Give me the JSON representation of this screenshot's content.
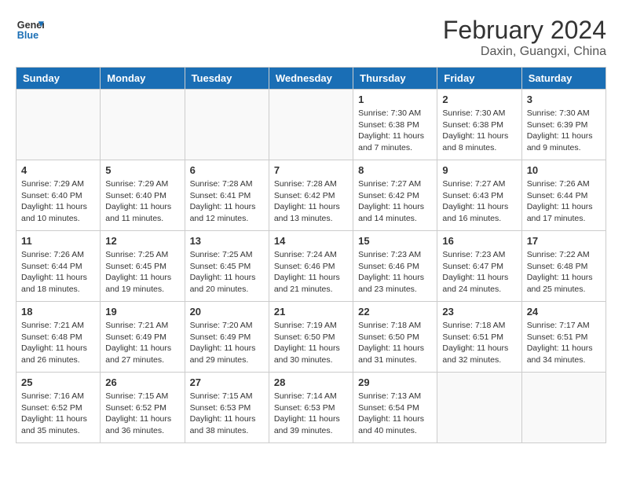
{
  "header": {
    "logo_line1": "General",
    "logo_line2": "Blue",
    "title": "February 2024",
    "subtitle": "Daxin, Guangxi, China"
  },
  "weekdays": [
    "Sunday",
    "Monday",
    "Tuesday",
    "Wednesday",
    "Thursday",
    "Friday",
    "Saturday"
  ],
  "weeks": [
    [
      {
        "day": "",
        "info": ""
      },
      {
        "day": "",
        "info": ""
      },
      {
        "day": "",
        "info": ""
      },
      {
        "day": "",
        "info": ""
      },
      {
        "day": "1",
        "info": "Sunrise: 7:30 AM\nSunset: 6:38 PM\nDaylight: 11 hours and 7 minutes."
      },
      {
        "day": "2",
        "info": "Sunrise: 7:30 AM\nSunset: 6:38 PM\nDaylight: 11 hours and 8 minutes."
      },
      {
        "day": "3",
        "info": "Sunrise: 7:30 AM\nSunset: 6:39 PM\nDaylight: 11 hours and 9 minutes."
      }
    ],
    [
      {
        "day": "4",
        "info": "Sunrise: 7:29 AM\nSunset: 6:40 PM\nDaylight: 11 hours and 10 minutes."
      },
      {
        "day": "5",
        "info": "Sunrise: 7:29 AM\nSunset: 6:40 PM\nDaylight: 11 hours and 11 minutes."
      },
      {
        "day": "6",
        "info": "Sunrise: 7:28 AM\nSunset: 6:41 PM\nDaylight: 11 hours and 12 minutes."
      },
      {
        "day": "7",
        "info": "Sunrise: 7:28 AM\nSunset: 6:42 PM\nDaylight: 11 hours and 13 minutes."
      },
      {
        "day": "8",
        "info": "Sunrise: 7:27 AM\nSunset: 6:42 PM\nDaylight: 11 hours and 14 minutes."
      },
      {
        "day": "9",
        "info": "Sunrise: 7:27 AM\nSunset: 6:43 PM\nDaylight: 11 hours and 16 minutes."
      },
      {
        "day": "10",
        "info": "Sunrise: 7:26 AM\nSunset: 6:44 PM\nDaylight: 11 hours and 17 minutes."
      }
    ],
    [
      {
        "day": "11",
        "info": "Sunrise: 7:26 AM\nSunset: 6:44 PM\nDaylight: 11 hours and 18 minutes."
      },
      {
        "day": "12",
        "info": "Sunrise: 7:25 AM\nSunset: 6:45 PM\nDaylight: 11 hours and 19 minutes."
      },
      {
        "day": "13",
        "info": "Sunrise: 7:25 AM\nSunset: 6:45 PM\nDaylight: 11 hours and 20 minutes."
      },
      {
        "day": "14",
        "info": "Sunrise: 7:24 AM\nSunset: 6:46 PM\nDaylight: 11 hours and 21 minutes."
      },
      {
        "day": "15",
        "info": "Sunrise: 7:23 AM\nSunset: 6:46 PM\nDaylight: 11 hours and 23 minutes."
      },
      {
        "day": "16",
        "info": "Sunrise: 7:23 AM\nSunset: 6:47 PM\nDaylight: 11 hours and 24 minutes."
      },
      {
        "day": "17",
        "info": "Sunrise: 7:22 AM\nSunset: 6:48 PM\nDaylight: 11 hours and 25 minutes."
      }
    ],
    [
      {
        "day": "18",
        "info": "Sunrise: 7:21 AM\nSunset: 6:48 PM\nDaylight: 11 hours and 26 minutes."
      },
      {
        "day": "19",
        "info": "Sunrise: 7:21 AM\nSunset: 6:49 PM\nDaylight: 11 hours and 27 minutes."
      },
      {
        "day": "20",
        "info": "Sunrise: 7:20 AM\nSunset: 6:49 PM\nDaylight: 11 hours and 29 minutes."
      },
      {
        "day": "21",
        "info": "Sunrise: 7:19 AM\nSunset: 6:50 PM\nDaylight: 11 hours and 30 minutes."
      },
      {
        "day": "22",
        "info": "Sunrise: 7:18 AM\nSunset: 6:50 PM\nDaylight: 11 hours and 31 minutes."
      },
      {
        "day": "23",
        "info": "Sunrise: 7:18 AM\nSunset: 6:51 PM\nDaylight: 11 hours and 32 minutes."
      },
      {
        "day": "24",
        "info": "Sunrise: 7:17 AM\nSunset: 6:51 PM\nDaylight: 11 hours and 34 minutes."
      }
    ],
    [
      {
        "day": "25",
        "info": "Sunrise: 7:16 AM\nSunset: 6:52 PM\nDaylight: 11 hours and 35 minutes."
      },
      {
        "day": "26",
        "info": "Sunrise: 7:15 AM\nSunset: 6:52 PM\nDaylight: 11 hours and 36 minutes."
      },
      {
        "day": "27",
        "info": "Sunrise: 7:15 AM\nSunset: 6:53 PM\nDaylight: 11 hours and 38 minutes."
      },
      {
        "day": "28",
        "info": "Sunrise: 7:14 AM\nSunset: 6:53 PM\nDaylight: 11 hours and 39 minutes."
      },
      {
        "day": "29",
        "info": "Sunrise: 7:13 AM\nSunset: 6:54 PM\nDaylight: 11 hours and 40 minutes."
      },
      {
        "day": "",
        "info": ""
      },
      {
        "day": "",
        "info": ""
      }
    ]
  ]
}
